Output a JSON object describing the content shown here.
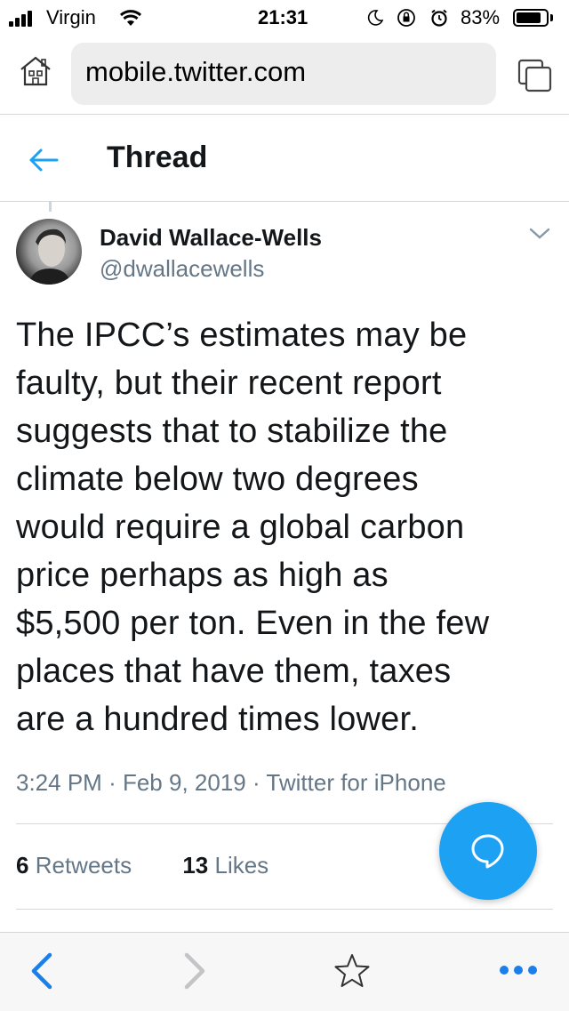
{
  "status_bar": {
    "carrier": "Virgin",
    "time": "21:31",
    "battery_percent": "83%",
    "battery_level": 0.83,
    "icons": [
      "signal-icon",
      "wifi-icon",
      "moon-icon",
      "orientation-lock-icon",
      "alarm-icon",
      "battery-icon"
    ]
  },
  "browser": {
    "url": "mobile.twitter.com",
    "icons": [
      "home-icon",
      "tabs-icon"
    ]
  },
  "header": {
    "title": "Thread",
    "back_icon": "back-arrow-icon"
  },
  "tweet": {
    "author_name": "David Wallace-Wells",
    "handle": "@dwallacewells",
    "text_lines": [
      "The IPCC’s estimates may be",
      "faulty, but their recent report",
      "suggests that to stabilize the",
      "climate below two degrees",
      "would require a global carbon",
      "price perhaps as high as",
      "$5,500 per ton. Even in the few",
      "places that have them, taxes",
      "are a hundred times lower."
    ],
    "time": "3:24 PM",
    "date": "Feb 9, 2019",
    "source": "Twitter for iPhone",
    "separator": "·",
    "retweets_count": "6",
    "retweets_label": "Retweets",
    "likes_count": "13",
    "likes_label": "Likes"
  },
  "fab": {
    "icon": "reply-bubble-icon"
  },
  "toolbar": {
    "icons": [
      "back-icon",
      "forward-icon",
      "star-icon",
      "more-icon"
    ]
  },
  "colors": {
    "accent": "#1da1f2",
    "secondary_text": "#657786",
    "primary_text": "#14171a"
  }
}
